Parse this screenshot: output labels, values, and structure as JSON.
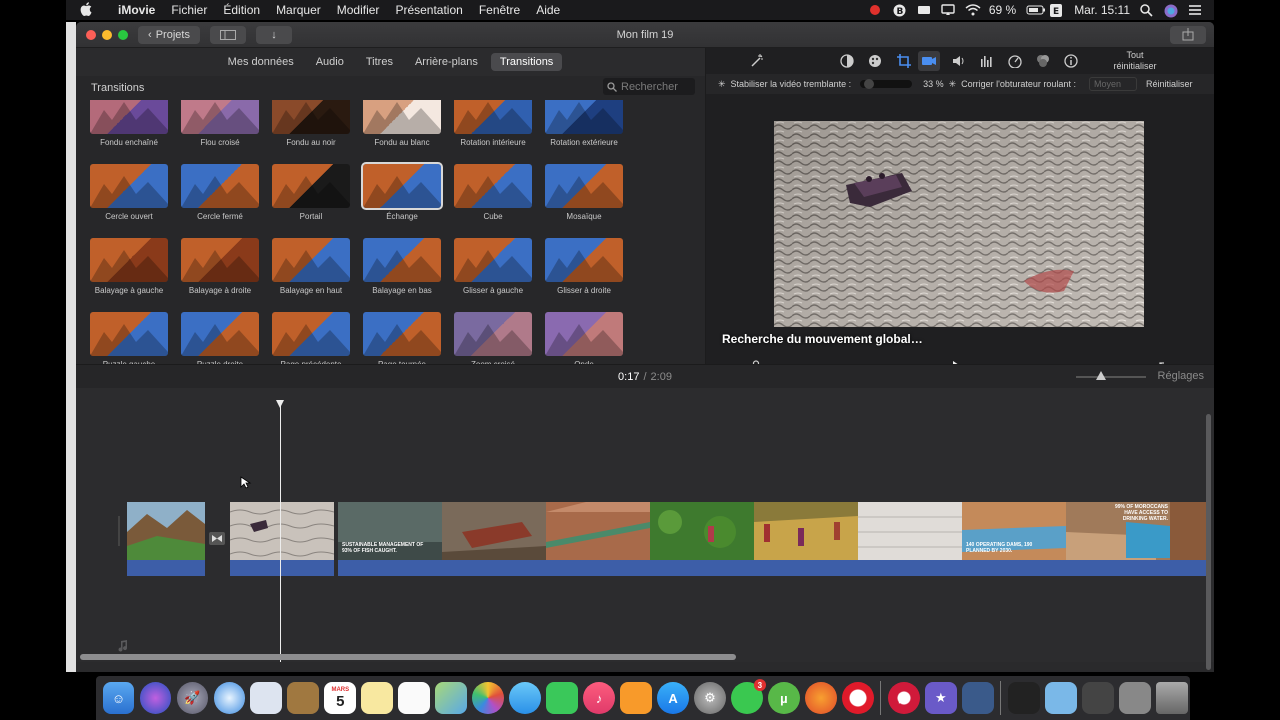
{
  "menubar": {
    "app_name": "iMovie",
    "items": [
      "Fichier",
      "Édition",
      "Marquer",
      "Modifier",
      "Présentation",
      "Fenêtre",
      "Aide"
    ],
    "battery": "69 %",
    "clock": "Mar. 15:11"
  },
  "window": {
    "title": "Mon film 19",
    "projects_label": "Projets"
  },
  "tabs": [
    {
      "label": "Mes données",
      "active": false
    },
    {
      "label": "Audio",
      "active": false
    },
    {
      "label": "Titres",
      "active": false
    },
    {
      "label": "Arrière-plans",
      "active": false
    },
    {
      "label": "Transitions",
      "active": true
    }
  ],
  "browser": {
    "heading": "Transitions",
    "search_placeholder": "Rechercher",
    "items": [
      {
        "label": "Fondu enchaîné",
        "colors": [
          "#b46a7a",
          "#6a4a9a"
        ]
      },
      {
        "label": "Flou croisé",
        "colors": [
          "#c07a8a",
          "#8a6aaa"
        ]
      },
      {
        "label": "Fondu au noir",
        "colors": [
          "#8a4a2a",
          "#2a1a10"
        ]
      },
      {
        "label": "Fondu au blanc",
        "colors": [
          "#d8a080",
          "#f4e8e0"
        ]
      },
      {
        "label": "Rotation intérieure",
        "colors": [
          "#c0602a",
          "#3060b0"
        ]
      },
      {
        "label": "Rotation extérieure",
        "colors": [
          "#3b6fc4",
          "#1e3f80"
        ]
      },
      {
        "label": "Cercle ouvert",
        "colors": [
          "#c0602a",
          "#3b6fc4"
        ]
      },
      {
        "label": "Cercle fermé",
        "colors": [
          "#3b6fc4",
          "#c0602a"
        ]
      },
      {
        "label": "Portail",
        "colors": [
          "#c0602a",
          "#1a1a1a"
        ]
      },
      {
        "label": "Échange",
        "colors": [
          "#c0602a",
          "#3b6fc4"
        ]
      },
      {
        "label": "Cube",
        "colors": [
          "#c0602a",
          "#3b6fc4"
        ]
      },
      {
        "label": "Mosaïque",
        "colors": [
          "#3b6fc4",
          "#c0602a"
        ]
      },
      {
        "label": "Balayage à gauche",
        "colors": [
          "#c0602a",
          "#8a3a1a"
        ]
      },
      {
        "label": "Balayage à droite",
        "colors": [
          "#c0602a",
          "#8a3a1a"
        ]
      },
      {
        "label": "Balayage en haut",
        "colors": [
          "#c0602a",
          "#3b6fc4"
        ]
      },
      {
        "label": "Balayage en bas",
        "colors": [
          "#3b6fc4",
          "#c0602a"
        ]
      },
      {
        "label": "Glisser à gauche",
        "colors": [
          "#c0602a",
          "#3b6fc4"
        ]
      },
      {
        "label": "Glisser à droite",
        "colors": [
          "#3b6fc4",
          "#c0602a"
        ]
      },
      {
        "label": "Puzzle gauche",
        "colors": [
          "#c0602a",
          "#3b6fc4"
        ]
      },
      {
        "label": "Puzzle droite",
        "colors": [
          "#3b6fc4",
          "#c0602a"
        ]
      },
      {
        "label": "Page précédente",
        "colors": [
          "#c0602a",
          "#3b6fc4"
        ]
      },
      {
        "label": "Page tournée",
        "colors": [
          "#3b6fc4",
          "#c0602a"
        ]
      },
      {
        "label": "Zoom croisé",
        "colors": [
          "#7a6aa0",
          "#b07a8a"
        ]
      },
      {
        "label": "Onde",
        "colors": [
          "#8a6ab0",
          "#c07a7a"
        ]
      }
    ],
    "selected": "Échange"
  },
  "viewer": {
    "reset_all": "Tout réinitialiser",
    "stabilize_label": "Stabiliser la vidéo tremblante :",
    "stabilize_value": "33 %",
    "rolling_label": "Corriger l'obturateur roulant :",
    "rolling_value": "Moyen",
    "reset_label": "Réinitialiser",
    "caption": "Recherche du mouvement global…"
  },
  "playback": {
    "current": "0:17",
    "separator": "/",
    "duration": "2:09",
    "settings_label": "Réglages"
  },
  "timeline": {
    "overlay_texts": [
      "SUSTAINABLE MANAGEMENT OF 93% OF FISH CAUGHT.",
      "140 OPERATING DAMS, 190 PLANNED BY 2030.",
      "99% OF MOROCCANS HAVE ACCESS TO DRINKING WATER."
    ]
  },
  "dock": {
    "calendar_month": "MARS",
    "calendar_day": "5",
    "badge_count": "3"
  },
  "colors": {
    "accent": "#3b6fc4",
    "audio": "#3d5ea8"
  }
}
